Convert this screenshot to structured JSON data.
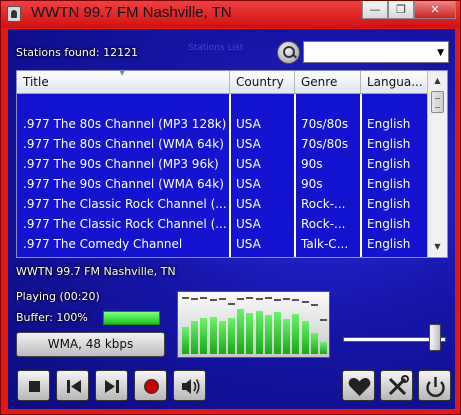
{
  "window": {
    "title": "WWTN 99.7 FM Nashville, TN",
    "buttons": {
      "minimize": "—",
      "maximize": "❐",
      "close": "✕"
    }
  },
  "search": {
    "stations_found": "Stations found: 12121",
    "faint_label": "Stations List",
    "query_value": ""
  },
  "table": {
    "columns": [
      "Title",
      "Country",
      "Genre",
      "Langua..."
    ],
    "rows": [
      [
        "",
        "",
        "",
        ""
      ],
      [
        ".977 The 80s Channel (MP3 128k)",
        "USA",
        "70s/80s",
        "English"
      ],
      [
        ".977 The 80s Channel (WMA 64k)",
        "USA",
        "70s/80s",
        "English"
      ],
      [
        ".977 The 90s Channel (MP3 96k)",
        "USA",
        "90s",
        "English"
      ],
      [
        ".977 The 90s Channel (WMA 64k)",
        "USA",
        "90s",
        "English"
      ],
      [
        ".977 The Classic Rock Channel (...",
        "USA",
        "Rock-...",
        "English"
      ],
      [
        ".977 The Classic Rock Channel (...",
        "USA",
        "Rock-...",
        "English"
      ],
      [
        ".977 The Comedy Channel",
        "USA",
        "Talk-C...",
        "English"
      ]
    ]
  },
  "player": {
    "now_playing": "WWTN 99.7 FM Nashville, TN",
    "status": "Playing (00:20)",
    "buffer_label": "Buffer: 100%",
    "buffer_level": 1.0,
    "codec": "WMA, 48 kbps",
    "volume_level": 0.95,
    "spectrum_levels": [
      0.45,
      0.55,
      0.6,
      0.62,
      0.55,
      0.6,
      0.75,
      0.68,
      0.72,
      0.65,
      0.7,
      0.58,
      0.66,
      0.55,
      0.35,
      0.2
    ],
    "spectrum_peaks": [
      0.92,
      0.9,
      0.92,
      0.88,
      0.9,
      0.82,
      0.9,
      0.92,
      0.9,
      0.92,
      0.88,
      0.9,
      0.88,
      0.85,
      0.8,
      0.55
    ]
  },
  "controls": {
    "stop": "stop-icon",
    "previous": "previous-icon",
    "next": "next-icon",
    "record": "record-icon",
    "volume": "speaker-icon",
    "favorites": "heart-icon",
    "settings": "tools-icon",
    "power": "power-icon"
  },
  "colors": {
    "frame": "#e21818",
    "background": "#1616a8",
    "table_background": "#1313d0",
    "spectrum_bar": "#3fd93f"
  }
}
